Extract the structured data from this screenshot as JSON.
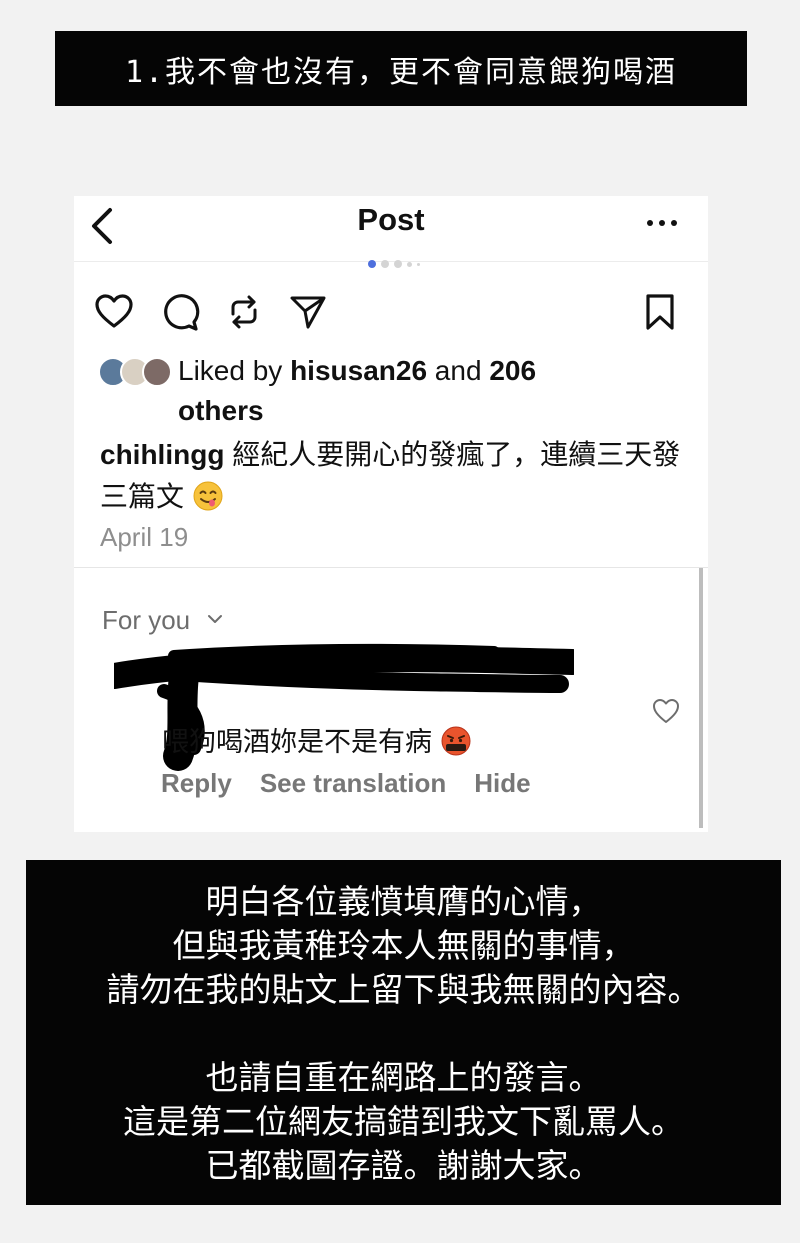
{
  "banner": {
    "text": "1.我不會也沒有，更不會同意餵狗喝酒"
  },
  "post_header": {
    "title": "Post"
  },
  "carousel": {
    "dot_count": 5,
    "active_index": 0
  },
  "icons": [
    "chevron-left-icon",
    "more-icon",
    "heart-icon",
    "comment-icon",
    "repost-icon",
    "share-icon",
    "bookmark-icon",
    "chevron-down-icon"
  ],
  "likes": {
    "prefix": "Liked by ",
    "user": "hisusan26",
    "middle": " and ",
    "count": "206",
    "suffix": "others"
  },
  "caption": {
    "username": "chihlingg",
    "text": " 經紀人要開心的發瘋了，連續三天發三篇文"
  },
  "post_date": "April 19",
  "comments": {
    "filter_label": "For you",
    "comment_text": "喂狗喝酒妳是不是有病",
    "actions": [
      "Reply",
      "See translation",
      "Hide"
    ]
  },
  "statement": {
    "lines": [
      "明白各位義憤填膺的心情，",
      "但與我黃稚玲本人無關的事情，",
      "請勿在我的貼文上留下與我無關的內容。",
      "",
      "也請自重在網路上的發言。",
      "這是第二位網友搞錯到我文下亂罵人。",
      "已都截圖存證。謝謝大家。"
    ]
  },
  "colors": {
    "accent_dot": "#4e6fdd",
    "banner_bg": "#050505",
    "redaction": "#000000"
  }
}
